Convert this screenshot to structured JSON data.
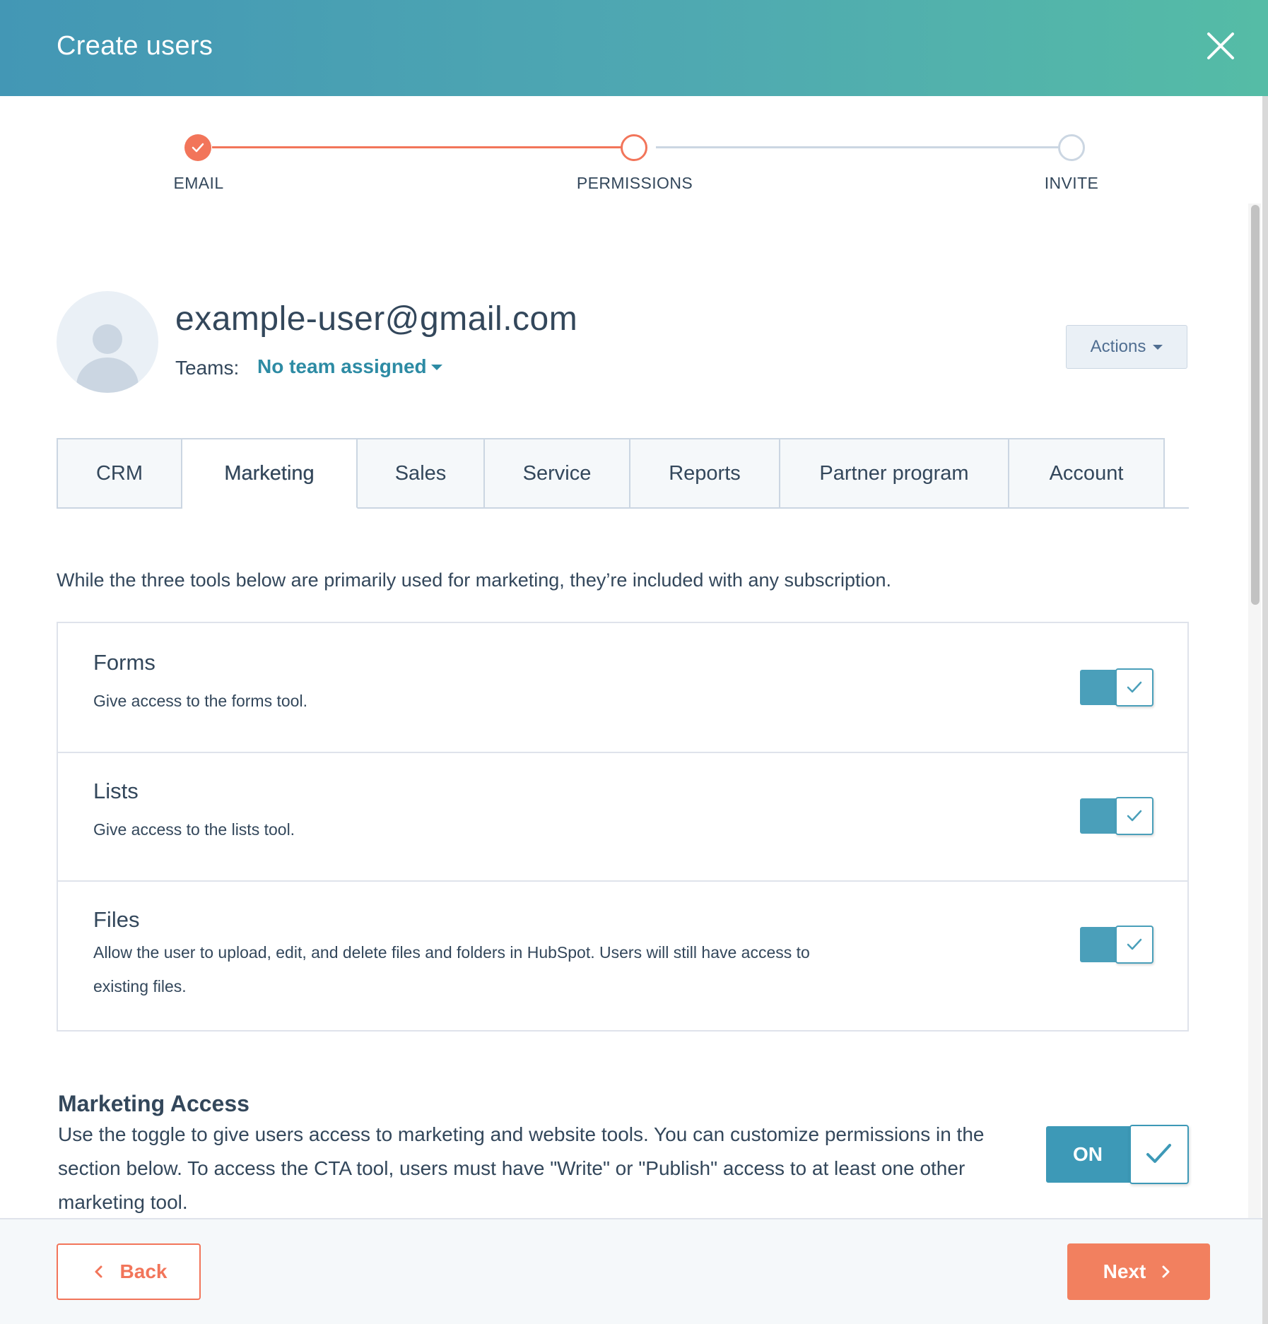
{
  "header": {
    "title": "Create users",
    "close_icon": "close-icon"
  },
  "stepper": {
    "steps": [
      {
        "label": "EMAIL",
        "state": "complete"
      },
      {
        "label": "PERMISSIONS",
        "state": "current"
      },
      {
        "label": "INVITE",
        "state": "upcoming"
      }
    ]
  },
  "profile": {
    "email": "example-user@gmail.com",
    "teams_label": "Teams:",
    "teams_value": "No team assigned",
    "actions_label": "Actions"
  },
  "tabs": [
    {
      "label": "CRM",
      "active": false
    },
    {
      "label": "Marketing",
      "active": true
    },
    {
      "label": "Sales",
      "active": false
    },
    {
      "label": "Service",
      "active": false
    },
    {
      "label": "Reports",
      "active": false
    },
    {
      "label": "Partner program",
      "active": false
    },
    {
      "label": "Account",
      "active": false
    }
  ],
  "marketing": {
    "intro": "While the three tools below are primarily used for marketing, they’re included with any subscription.",
    "tools": [
      {
        "title": "Forms",
        "desc": "Give access to the forms tool.",
        "enabled": true
      },
      {
        "title": "Lists",
        "desc": "Give access to the lists tool.",
        "enabled": true
      },
      {
        "title": "Files",
        "desc": "Allow the user to upload, edit, and delete files and folders in HubSpot. Users will still have access to existing files.",
        "enabled": true
      }
    ],
    "access_title": "Marketing Access",
    "access_desc": "Use the toggle to give users access to marketing and website tools. You can customize permissions in the section below. To access the CTA tool, users must have \"Write\" or \"Publish\" access to at least one other marketing tool.",
    "access_toggle_label": "ON",
    "access_enabled": true
  },
  "footer": {
    "back_label": "Back",
    "next_label": "Next"
  },
  "colors": {
    "accent_orange": "#f2755a",
    "accent_teal": "#4a9fba",
    "text": "#33475b"
  }
}
